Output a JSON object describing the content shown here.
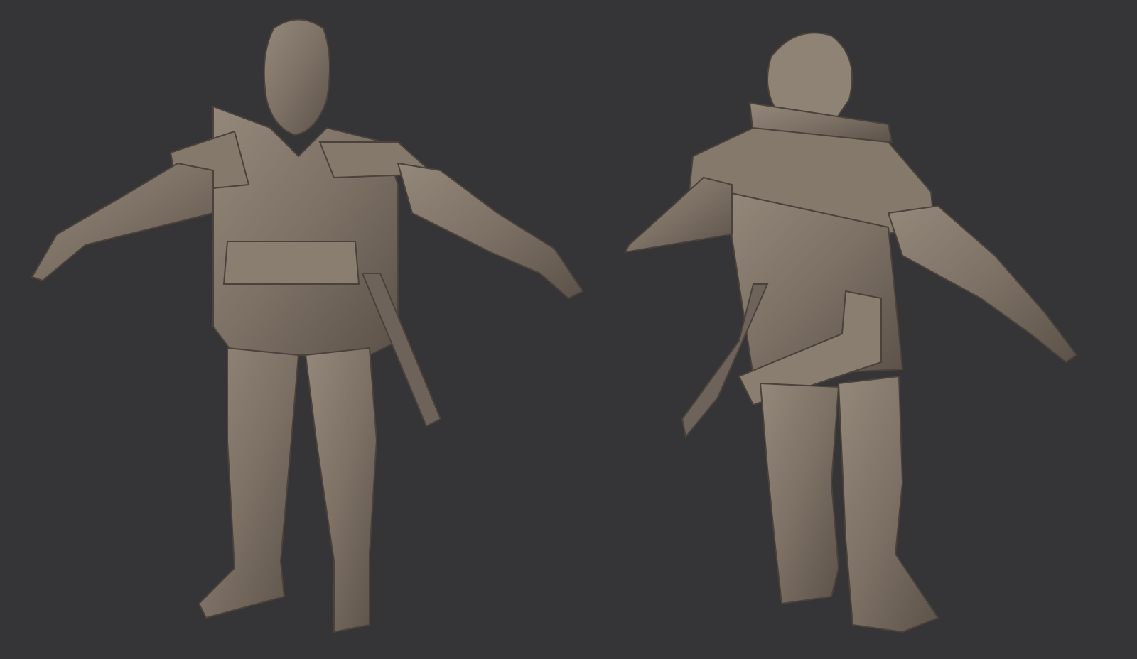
{
  "scene": {
    "background_color": "#353537",
    "clay_color": "#7d7165",
    "clay_shadow": "#5a5047",
    "clay_highlight": "#a3978a",
    "views": [
      {
        "name": "front-view"
      },
      {
        "name": "back-view"
      }
    ]
  }
}
